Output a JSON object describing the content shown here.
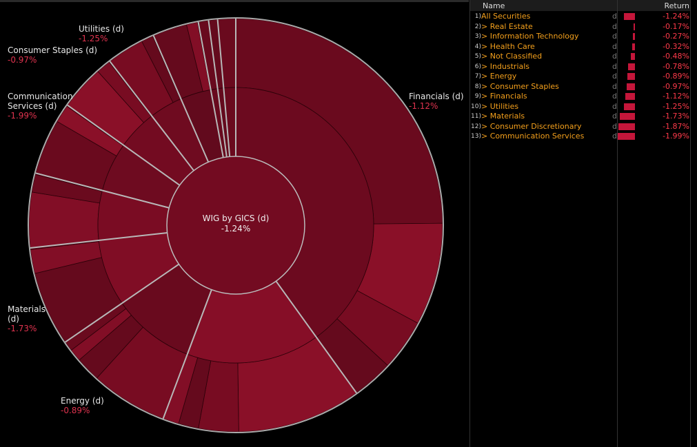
{
  "chart_data": {
    "type": "sunburst",
    "title": "WIG by GICS (d)",
    "total_return": "-1.24%",
    "sectors": [
      {
        "name": "Financials (d)",
        "return": "-1.12%",
        "weight_pct": 40.0,
        "color": "#6c0a1f"
      },
      {
        "name": "Consumer Discretionary (d)",
        "return": "-1.87%",
        "weight_pct": 15.6,
        "color": "#860e27"
      },
      {
        "name": "Energy (d)",
        "return": "-0.89%",
        "weight_pct": 9.7,
        "color": "#690a1e"
      },
      {
        "name": "Materials (d)",
        "return": "-1.73%",
        "weight_pct": 7.8,
        "color": "#800d25"
      },
      {
        "name": "Industrials (d)",
        "return": "-0.78%",
        "weight_pct": 5.8,
        "color": "#7a0c23"
      },
      {
        "name": "Communication Services (d)",
        "return": "-1.99%",
        "weight_pct": 5.8,
        "color": "#6e0b20"
      },
      {
        "name": "Consumer Staples (d)",
        "return": "-0.97%",
        "weight_pct": 4.7,
        "color": "#730b21"
      },
      {
        "name": "Utilities (d)",
        "return": "-1.25%",
        "weight_pct": 3.9,
        "color": "#6f0b20"
      },
      {
        "name": "Health Care (d)",
        "return": "-0.32%",
        "weight_pct": 3.6,
        "color": "#620a1d"
      },
      {
        "name": "Information Technology (d)",
        "return": "-0.27%",
        "weight_pct": 0.8,
        "color": "#680a1e"
      },
      {
        "name": "Real Estate (d)",
        "return": "-0.17%",
        "weight_pct": 0.7,
        "color": "#640a1d"
      },
      {
        "name": "Not Classified (d)",
        "return": "-0.48%",
        "weight_pct": 1.4,
        "color": "#6a0a1e"
      }
    ],
    "labels": [
      {
        "name": "Financials (d)",
        "return": "-1.12%"
      },
      {
        "name": "Utilities (d)",
        "return": "-1.25%"
      },
      {
        "name": "Consumer Staples (d)",
        "return": "-0.97%"
      },
      {
        "name": "Communication Services (d)",
        "return": "-1.99%"
      },
      {
        "name": "Materials (d)",
        "return": "-1.73%"
      },
      {
        "name": "Energy (d)",
        "return": "-0.89%"
      }
    ]
  },
  "table": {
    "headers": {
      "name": "Name",
      "return": "Return"
    },
    "bar_color": "#c4163a",
    "rows": [
      {
        "idx": "1)",
        "name": "All Securities",
        "flag": "d",
        "return": "-1.24%",
        "value": -1.24
      },
      {
        "idx": "2)",
        "name": "> Real Estate",
        "flag": "d",
        "return": "-0.17%",
        "value": -0.17
      },
      {
        "idx": "3)",
        "name": "> Information Technology",
        "flag": "d",
        "return": "-0.27%",
        "value": -0.27
      },
      {
        "idx": "4)",
        "name": "> Health Care",
        "flag": "d",
        "return": "-0.32%",
        "value": -0.32
      },
      {
        "idx": "5)",
        "name": "> Not Classified",
        "flag": "d",
        "return": "-0.48%",
        "value": -0.48
      },
      {
        "idx": "6)",
        "name": "> Industrials",
        "flag": "d",
        "return": "-0.78%",
        "value": -0.78
      },
      {
        "idx": "7)",
        "name": "> Energy",
        "flag": "d",
        "return": "-0.89%",
        "value": -0.89
      },
      {
        "idx": "8)",
        "name": "> Consumer Staples",
        "flag": "d",
        "return": "-0.97%",
        "value": -0.97
      },
      {
        "idx": "9)",
        "name": "> Financials",
        "flag": "d",
        "return": "-1.12%",
        "value": -1.12
      },
      {
        "idx": "10)",
        "name": "> Utilities",
        "flag": "d",
        "return": "-1.25%",
        "value": -1.25
      },
      {
        "idx": "11)",
        "name": "> Materials",
        "flag": "d",
        "return": "-1.73%",
        "value": -1.73
      },
      {
        "idx": "12)",
        "name": "> Consumer Discretionary",
        "flag": "d",
        "return": "-1.87%",
        "value": -1.87
      },
      {
        "idx": "13)",
        "name": "> Communication Services",
        "flag": "d",
        "return": "-1.99%",
        "value": -1.99
      }
    ]
  }
}
